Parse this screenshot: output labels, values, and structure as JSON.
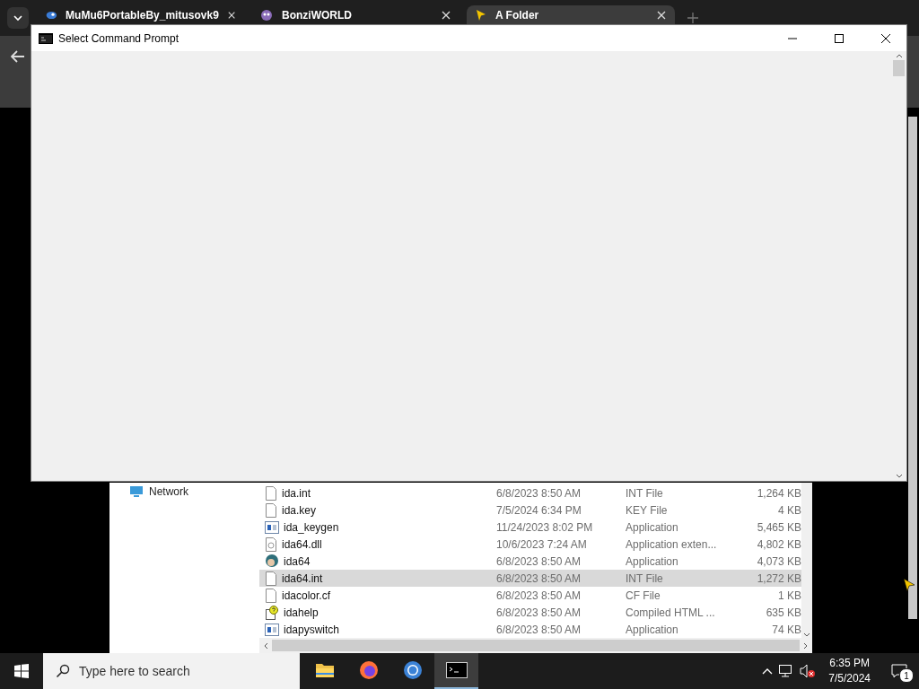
{
  "browser": {
    "tabs": [
      {
        "label": "MuMu6PortableBy_mitusovk9",
        "kind": "app",
        "selected": false
      },
      {
        "label": "BonziWORLD",
        "kind": "bonzi",
        "selected": false
      },
      {
        "label": "A Folder",
        "kind": "cursor",
        "selected": true
      }
    ]
  },
  "explorer": {
    "nav_items": [
      "Network"
    ],
    "files": [
      {
        "name": "ida.int",
        "modified": "6/8/2023 8:50 AM",
        "type": "INT File",
        "size": "1,264 KB",
        "kind": "blank",
        "selected": false
      },
      {
        "name": "ida.key",
        "modified": "7/5/2024 6:34 PM",
        "type": "KEY File",
        "size": "4 KB",
        "kind": "blank",
        "selected": false
      },
      {
        "name": "ida_keygen",
        "modified": "11/24/2023 8:02 PM",
        "type": "Application",
        "size": "5,465 KB",
        "kind": "app",
        "selected": false
      },
      {
        "name": "ida64.dll",
        "modified": "10/6/2023 7:24 AM",
        "type": "Application exten...",
        "size": "4,802 KB",
        "kind": "dll",
        "selected": false
      },
      {
        "name": "ida64",
        "modified": "6/8/2023 8:50 AM",
        "type": "Application",
        "size": "4,073 KB",
        "kind": "ida",
        "selected": false
      },
      {
        "name": "ida64.int",
        "modified": "6/8/2023 8:50 AM",
        "type": "INT File",
        "size": "1,272 KB",
        "kind": "blank",
        "selected": true
      },
      {
        "name": "idacolor.cf",
        "modified": "6/8/2023 8:50 AM",
        "type": "CF File",
        "size": "1 KB",
        "kind": "blank",
        "selected": false
      },
      {
        "name": "idahelp",
        "modified": "6/8/2023 8:50 AM",
        "type": "Compiled HTML ...",
        "size": "635 KB",
        "kind": "help",
        "selected": false
      },
      {
        "name": "idapyswitch",
        "modified": "6/8/2023 8:50 AM",
        "type": "Application",
        "size": "74 KB",
        "kind": "app",
        "selected": false
      }
    ]
  },
  "cmd_window": {
    "title": "Select Command Prompt"
  },
  "taskbar": {
    "search": {
      "placeholder": "Type here to search"
    },
    "apps": [
      {
        "kind": "explorer",
        "active": false
      },
      {
        "kind": "firefox",
        "active": false
      },
      {
        "kind": "chrome",
        "active": false
      },
      {
        "kind": "terminal",
        "active": true
      }
    ],
    "time": "6:35 PM",
    "date": "7/5/2024",
    "notification_count": "1"
  }
}
